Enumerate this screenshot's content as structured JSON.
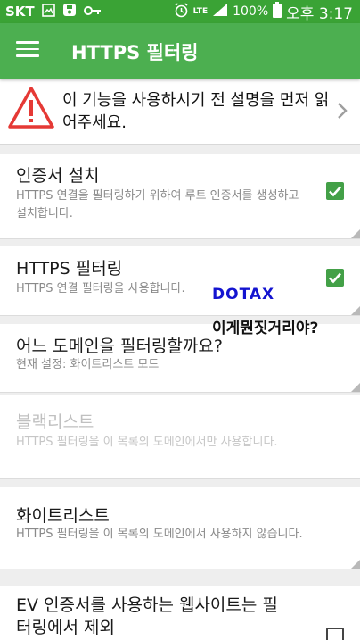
{
  "status_bar": {
    "carrier": "SKT",
    "network": "LTE",
    "battery": "100%",
    "time": "오후 3:17",
    "icons": [
      "image-icon",
      "save-icon",
      "key-icon",
      "alarm-icon",
      "signal-icon",
      "battery-icon"
    ]
  },
  "app_bar": {
    "title": "HTTPS 필터링",
    "menu_icon": "hamburger-menu-icon"
  },
  "warning": {
    "text": "이 기능을 사용하시기 전 설명을 먼저 읽어주세요.",
    "icon": "warning-triangle-icon",
    "color": "#e53935"
  },
  "settings": [
    {
      "title": "인증서 설치",
      "summary": "HTTPS 연결을 필터링하기 위하여 루트 인증서를 생성하고 설치합니다.",
      "checked": true,
      "enabled": true
    },
    {
      "title": "HTTPS 필터링",
      "summary": "HTTPS 연결 필터링을 사용합니다.",
      "checked": true,
      "enabled": true
    },
    {
      "title": "어느 도메인을 필터링할까요?",
      "summary": "현재 설정: 화이트리스트 모드",
      "enabled": true
    },
    {
      "title": "블랙리스트",
      "summary": "HTTPS 필터링을 이 목록의 도메인에서만 사용합니다.",
      "enabled": false
    },
    {
      "title": "화이트리스트",
      "summary": "HTTPS 필터링을 이 목록의 도메인에서 사용하지 않습니다.",
      "enabled": true
    },
    {
      "title": "EV 인증서를 사용하는 웹사이트는 필터링에서 제외",
      "checked": false,
      "enabled": true
    }
  ],
  "overlay": {
    "line1": "DOTAX",
    "line2": "이게뭔짓거리야?"
  },
  "colors": {
    "status_bar": "#3aa335",
    "app_bar": "#4caf50",
    "checkbox": "#43a047",
    "overlay_blue": "#1414d0"
  }
}
